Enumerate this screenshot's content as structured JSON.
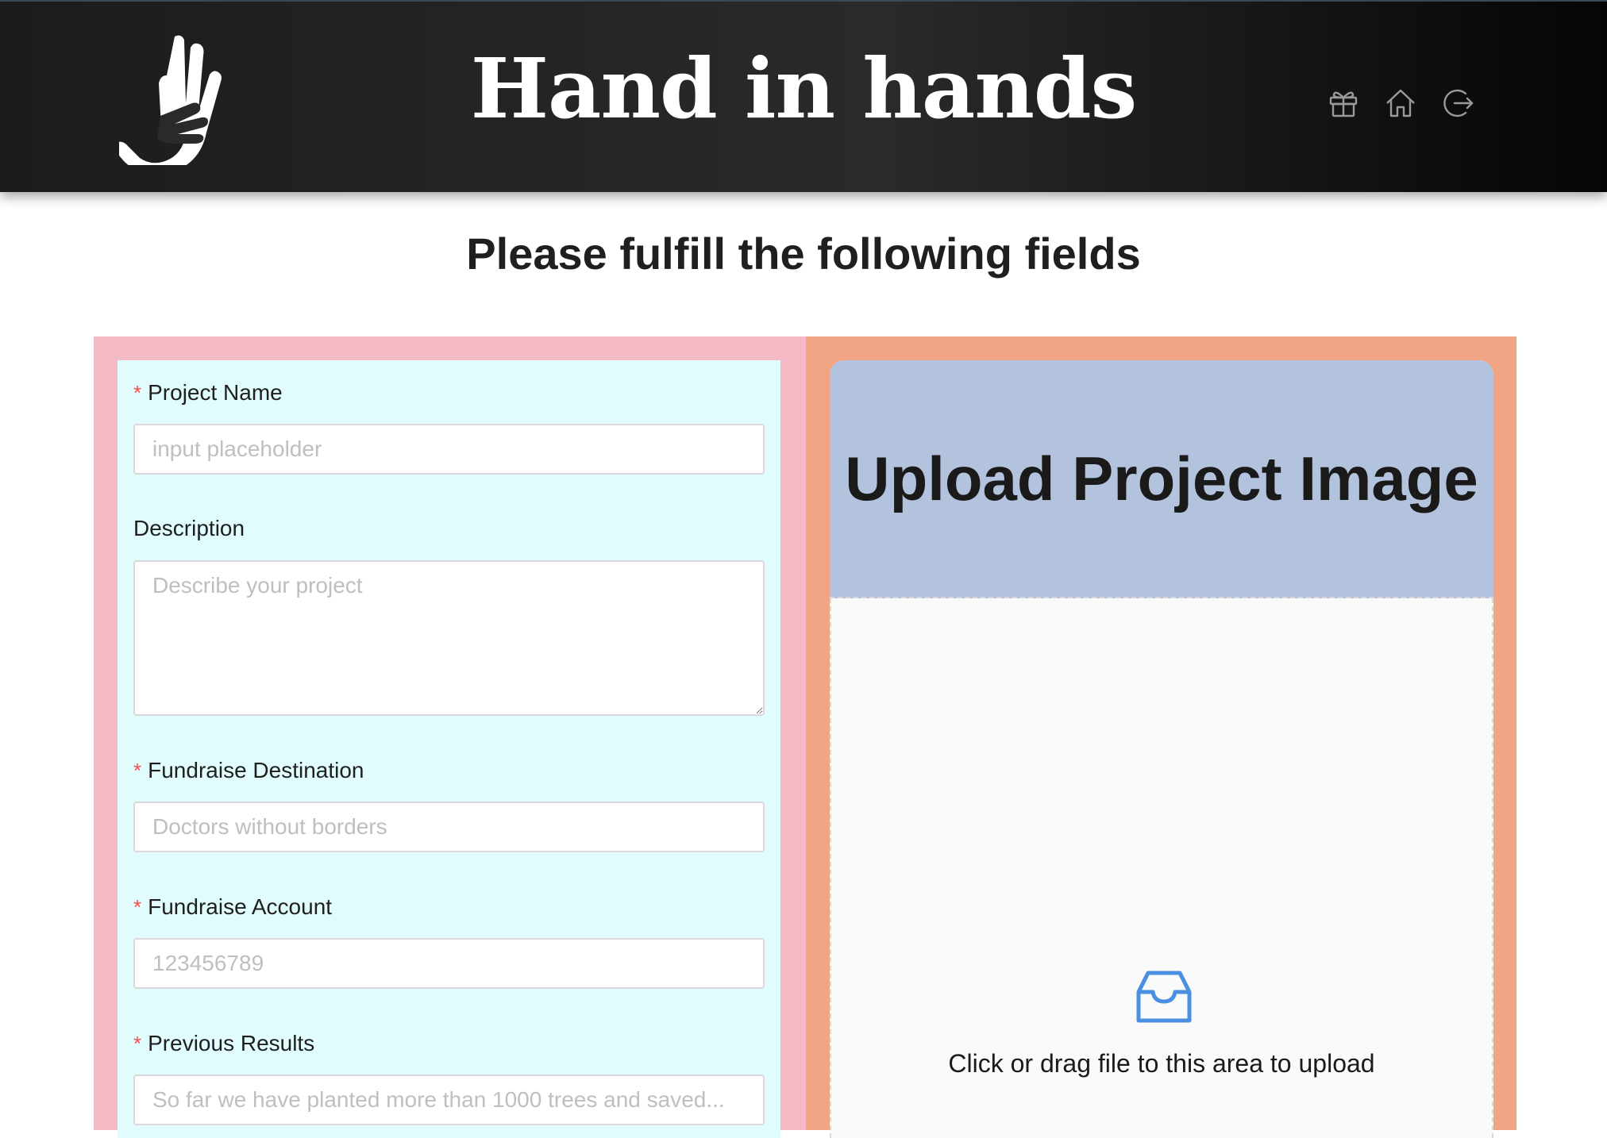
{
  "header": {
    "title": "Hand in hands",
    "nav_icons": [
      "gift-icon",
      "home-icon",
      "logout-icon"
    ]
  },
  "subtitle": "Please fulfill the following fields",
  "form": {
    "project_name": {
      "label": "Project Name",
      "required": true,
      "placeholder": "input placeholder"
    },
    "description": {
      "label": "Description",
      "required": false,
      "placeholder": "Describe your project"
    },
    "fundraise_destination": {
      "label": "Fundraise Destination",
      "required": true,
      "placeholder": "Doctors without borders"
    },
    "fundraise_account": {
      "label": "Fundraise Account",
      "required": true,
      "placeholder": "123456789"
    },
    "previous_results": {
      "label": "Previous Results",
      "required": true,
      "placeholder": "So far we have planted more than 1000 trees and saved..."
    }
  },
  "upload": {
    "title": "Upload Project Image",
    "hint": "Click or drag file to this area to upload",
    "icon": "inbox-icon"
  },
  "colors": {
    "header_bg": "#1c1c1c",
    "left_panel": "#f4bac5",
    "form_card": "#e1fcfc",
    "right_panel": "#f2a585",
    "upload_head": "#b3c3dd",
    "accent": "#4a90e2",
    "required": "#ff4d4f"
  }
}
